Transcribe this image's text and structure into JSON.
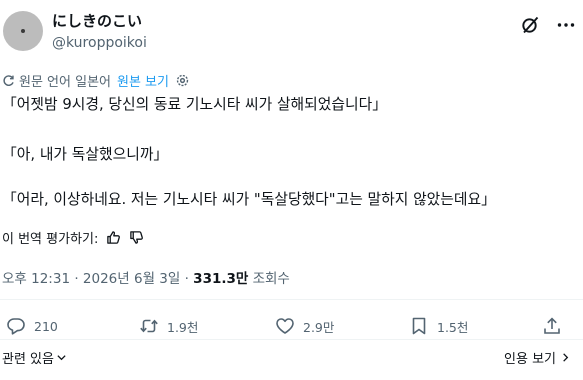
{
  "author": {
    "display_name": "にしきのこい",
    "handle": "@kuroppoikoi"
  },
  "translation": {
    "notice": "원문 언어 일본어",
    "view_original": "원본 보기"
  },
  "body_lines": [
    "「어젯밤 9시경, 당신의 동료 기노시타 씨가 살해되었습니다」",
    "「아, 내가 독살했으니까」",
    "「어라, 이상하네요. 저는 기노시타 씨가 \"독살당했다\"고는 말하지 않았는데요」"
  ],
  "rate_translation": "이 번역 평가하기:",
  "meta": {
    "time_date": "오후 12:31 · 2026년 6월 3일 · ",
    "views_count": "331.3만",
    "views_label": " 조회수"
  },
  "actions": {
    "replies": "210",
    "reposts": "1.9천",
    "likes": "2.9만",
    "bookmarks": "1.5천"
  },
  "footer": {
    "related": "관련 있음",
    "quotes": "인용 보기"
  }
}
